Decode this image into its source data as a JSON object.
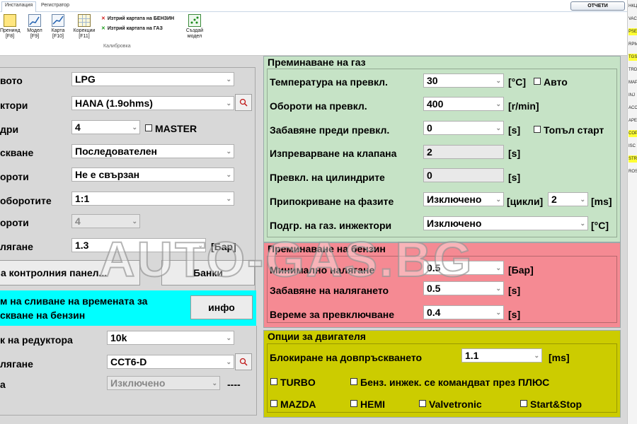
{
  "ribbon": {
    "tabs": [
      "Инсталация",
      "Регистратор"
    ],
    "close_map": "ОТЧЕТИ",
    "buttons": [
      {
        "label": "Пренинд\n[F8]"
      },
      {
        "label": "Модел\n[F9]"
      },
      {
        "label": "Карта\n[F10]"
      },
      {
        "label": "Корекции\n[F11]"
      }
    ],
    "actions": [
      "Изтрий картата на БЕНЗИН",
      "Изтрий картата на ГАЗ"
    ],
    "create_model": "Създай\nмодел",
    "group_label": "Калибровка"
  },
  "side_items": [
    {
      "label": "НКЦ",
      "highlight": false
    },
    {
      "label": "VAC",
      "highlight": false
    },
    {
      "label": "PSE",
      "highlight": true
    },
    {
      "label": "RPM",
      "highlight": false
    },
    {
      "label": "TGS",
      "highlight": true
    },
    {
      "label": "TRD",
      "highlight": false
    },
    {
      "label": "MAP",
      "highlight": false
    },
    {
      "label": "INJ",
      "highlight": false
    },
    {
      "label": "ACC",
      "highlight": false
    },
    {
      "label": "APE",
      "highlight": false
    },
    {
      "label": "COP",
      "highlight": true
    },
    {
      "label": "ISC",
      "highlight": false
    },
    {
      "label": "STR",
      "highlight": true
    },
    {
      "label": "ROSA",
      "highlight": false
    }
  ],
  "left": {
    "rows": [
      {
        "label": "вото",
        "value": "LPG",
        "disabled": false
      },
      {
        "label": "ктори",
        "value": "HANA (1.9ohms)",
        "disabled": false
      },
      {
        "label": "дри",
        "value": "4",
        "disabled": false
      },
      {
        "label": "скване",
        "value": "Последователен",
        "disabled": false
      },
      {
        "label": "ороти",
        "value": "Не е свързан",
        "disabled": false
      },
      {
        "label": "оборотите",
        "value": "1:1",
        "disabled": false
      },
      {
        "label": "ороти",
        "value": "4",
        "disabled": true
      },
      {
        "label": "лягане",
        "value": "1.3",
        "disabled": false
      }
    ],
    "master_label": "MASTER",
    "pressure_unit": "[Бар]",
    "panel_button": "а контролния панел...",
    "banks_button": "Банки",
    "cyan_text_line1": "м на сливане на времената за",
    "cyan_text_line2": "скване на бензин",
    "info_button": "инфо",
    "lower_rows": [
      {
        "label": "к на редуктора",
        "value": "10k",
        "disabled": false
      },
      {
        "label": "лягане",
        "value": "CCT6-D",
        "disabled": false
      },
      {
        "label": "а",
        "value": "Изключено",
        "disabled": true
      }
    ],
    "lower_dashes": "----"
  },
  "gas": {
    "title": "Преминаване на газ",
    "rows": [
      {
        "label": "Температура на превкл.",
        "value": "30",
        "unit": "[°C]"
      },
      {
        "label": "Обороти на превкл.",
        "value": "400",
        "unit": "[r/min]"
      },
      {
        "label": "Забавяне преди превкл.",
        "value": "0",
        "unit": "[s]"
      },
      {
        "label": "Изпреварване на клапана",
        "value": "2",
        "unit": "[s]"
      },
      {
        "label": "Превкл. на цилиндрите",
        "value": "0",
        "unit": "[s]"
      },
      {
        "label": "Припокриване на фазите",
        "value": "Изключено",
        "unit": "[цикли]"
      },
      {
        "label": "Подгр. на газ. инжектори",
        "value": "Изключено",
        "unit": "[°C]"
      }
    ],
    "auto_label": "Авто",
    "warm_start_label": "Топъл старт",
    "cycles_value": "2",
    "ms_unit": "[ms]"
  },
  "petrol": {
    "title": "Преминаване на бензин",
    "rows": [
      {
        "label": "Минимално налягане",
        "value": "0.5",
        "unit": "[Бар]"
      },
      {
        "label": "Забавяне на налягането",
        "value": "0.5",
        "unit": "[s]"
      },
      {
        "label": "Вереме за превключване",
        "value": "0.4",
        "unit": "[s]"
      }
    ]
  },
  "engine": {
    "title": "Опции за двигателя",
    "cutoff_label": "Блокиране на довпръскването",
    "cutoff_value": "1.1",
    "cutoff_unit": "[ms]",
    "options": [
      "TURBO",
      "Бенз. инжек. се командват през ПЛЮС",
      "MAZDA",
      "HEMI",
      "Valvetronic",
      "Start&Stop"
    ]
  },
  "watermark": "AUTO-GAS.BG"
}
